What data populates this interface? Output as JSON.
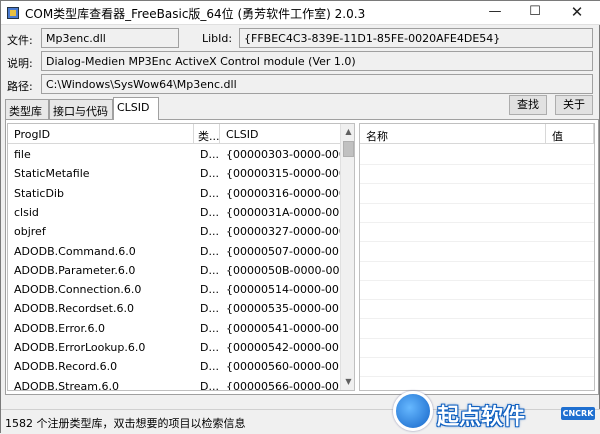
{
  "window": {
    "title": "COM类型库查看器_FreeBasic版_64位 (勇芳软件工作室) 2.0.3",
    "min_glyph": "—",
    "max_glyph": "☐",
    "close_glyph": "✕"
  },
  "info": {
    "file_label": "文件:",
    "file_value": "Mp3enc.dll",
    "libid_label": "LibId:",
    "libid_value": "{FFBEC4C3-839E-11D1-85FE-0020AFE4DE54}",
    "desc_label": "说明:",
    "desc_value": "Dialog-Medien MP3Enc ActiveX Control module (Ver 1.0)",
    "path_label": "路径:",
    "path_value": "C:\\Windows\\SysWow64\\Mp3enc.dll"
  },
  "tabs": [
    {
      "label": "类型库"
    },
    {
      "label": "接口与代码"
    },
    {
      "label": "CLSID"
    }
  ],
  "buttons": {
    "find": "查找",
    "about": "关于"
  },
  "left_grid": {
    "columns": [
      "ProgID",
      "类...",
      "CLSID"
    ],
    "rows": [
      {
        "progid": "file",
        "type": "D...",
        "clsid": "{00000303-0000-0000"
      },
      {
        "progid": "StaticMetafile",
        "type": "D...",
        "clsid": "{00000315-0000-0000"
      },
      {
        "progid": "StaticDib",
        "type": "D...",
        "clsid": "{00000316-0000-0000"
      },
      {
        "progid": "clsid",
        "type": "D...",
        "clsid": "{0000031A-0000-0000"
      },
      {
        "progid": "objref",
        "type": "D...",
        "clsid": "{00000327-0000-0000"
      },
      {
        "progid": "ADODB.Command.6.0",
        "type": "D...",
        "clsid": "{00000507-0000-0010"
      },
      {
        "progid": "ADODB.Parameter.6.0",
        "type": "D...",
        "clsid": "{0000050B-0000-0010"
      },
      {
        "progid": "ADODB.Connection.6.0",
        "type": "D...",
        "clsid": "{00000514-0000-0010"
      },
      {
        "progid": "ADODB.Recordset.6.0",
        "type": "D...",
        "clsid": "{00000535-0000-0010"
      },
      {
        "progid": "ADODB.Error.6.0",
        "type": "D...",
        "clsid": "{00000541-0000-0010"
      },
      {
        "progid": "ADODB.ErrorLookup.6.0",
        "type": "D...",
        "clsid": "{00000542-0000-0010"
      },
      {
        "progid": "ADODB.Record.6.0",
        "type": "D...",
        "clsid": "{00000560-0000-0010"
      },
      {
        "progid": "ADODB.Stream.6.0",
        "type": "D...",
        "clsid": "{00000566-0000-0010"
      }
    ]
  },
  "right_grid": {
    "columns": [
      "名称",
      "值"
    ]
  },
  "scrollbar": {
    "up_glyph": "▲",
    "down_glyph": "▼"
  },
  "status": {
    "text": "1582 个注册类型库，双击想要的项目以检索信息"
  },
  "watermark": {
    "text": "起点软件",
    "badge": "CNCRK"
  }
}
